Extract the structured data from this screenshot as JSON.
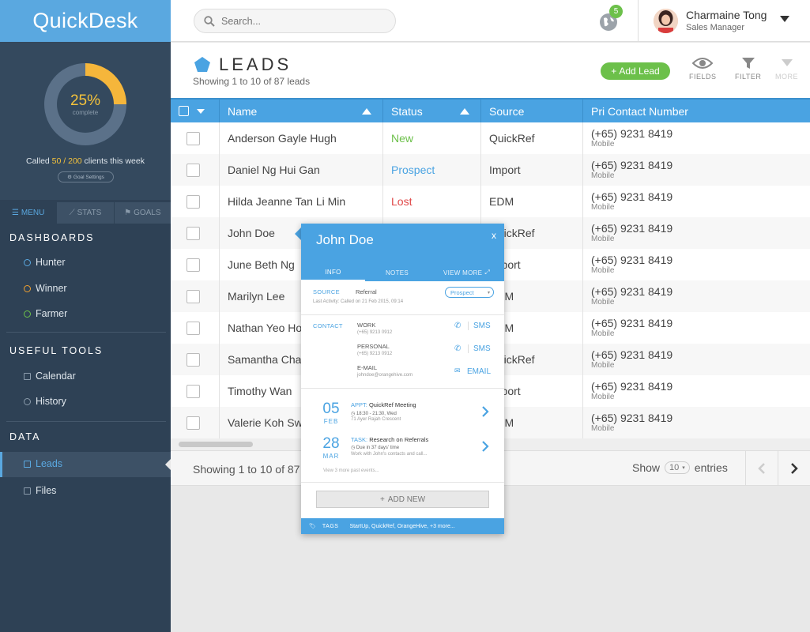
{
  "app": {
    "logo": "QuickDesk"
  },
  "stats": {
    "percent": "25%",
    "percent_value": 0.25,
    "complete_label": "complete",
    "called_prefix": "Called ",
    "called_count": "50 / 200",
    "called_suffix": " clients this week",
    "goal_settings": "Goal Settings"
  },
  "sidebar": {
    "tabs": [
      {
        "label": "MENU"
      },
      {
        "label": "STATS"
      },
      {
        "label": "GOALS"
      }
    ],
    "sections": {
      "dashboards": "DASHBOARDS",
      "useful_tools": "USEFUL TOOLS",
      "data": "DATA"
    },
    "dashboards": [
      {
        "label": "Hunter",
        "color": "#5aa8e0"
      },
      {
        "label": "Winner",
        "color": "#f0a030"
      },
      {
        "label": "Farmer",
        "color": "#6cc04a"
      }
    ],
    "tools": [
      {
        "label": "Calendar"
      },
      {
        "label": "History"
      }
    ],
    "data_items": [
      {
        "label": "Leads"
      },
      {
        "label": "Files"
      }
    ]
  },
  "header": {
    "search_placeholder": "Search...",
    "notifications": "5",
    "user_name": "Charmaine Tong",
    "user_role": "Sales Manager"
  },
  "leads": {
    "title": "LEADS",
    "subtitle": "Showing 1 to 10 of 87 leads",
    "add_label": "Add Lead",
    "actions": {
      "fields": "FIELDS",
      "filter": "FILTER",
      "more": "MORE"
    },
    "columns": {
      "name": "Name",
      "status": "Status",
      "source": "Source",
      "contact": "Pri Contact Number"
    },
    "rows": [
      {
        "name": "Anderson Gayle Hugh",
        "status": "New",
        "status_color": "#6cc04a",
        "source": "QuickRef",
        "phone": "(+65) 9231 8419",
        "phone_type": "Mobile"
      },
      {
        "name": "Daniel Ng Hui Gan",
        "status": "Prospect",
        "status_color": "#4aa3e2",
        "source": "Import",
        "phone": "(+65) 9231 8419",
        "phone_type": "Mobile"
      },
      {
        "name": "Hilda Jeanne Tan Li Min",
        "status": "Lost",
        "status_color": "#e04848",
        "source": "EDM",
        "phone": "(+65) 9231 8419",
        "phone_type": "Mobile"
      },
      {
        "name": "John Doe",
        "status": "",
        "status_color": "#444",
        "source": "QuickRef",
        "phone": "(+65) 9231 8419",
        "phone_type": "Mobile"
      },
      {
        "name": "June Beth Ng",
        "status": "",
        "status_color": "#444",
        "source": "Import",
        "phone": "(+65) 9231 8419",
        "phone_type": "Mobile"
      },
      {
        "name": "Marilyn Lee",
        "status": "",
        "status_color": "#444",
        "source": "EDM",
        "phone": "(+65) 9231 8419",
        "phone_type": "Mobile"
      },
      {
        "name": "Nathan Yeo Ho",
        "status": "",
        "status_color": "#444",
        "source": "EDM",
        "phone": "(+65) 9231 8419",
        "phone_type": "Mobile"
      },
      {
        "name": "Samantha Cha",
        "status": "",
        "status_color": "#444",
        "source": "QuickRef",
        "phone": "(+65) 9231 8419",
        "phone_type": "Mobile"
      },
      {
        "name": "Timothy Wan",
        "status": "",
        "status_color": "#444",
        "source": "Import",
        "phone": "(+65) 9231 8419",
        "phone_type": "Mobile"
      },
      {
        "name": "Valerie Koh Sw",
        "status": "",
        "status_color": "#444",
        "source": "EDM",
        "phone": "(+65) 9231 8419",
        "phone_type": "Mobile"
      }
    ],
    "footer_text": "Showing 1 to 10 of 87",
    "show_label": "Show",
    "entries_value": "10",
    "entries_label": "entries"
  },
  "popup": {
    "name": "John Doe",
    "close": "x",
    "tabs": {
      "info": "INFO",
      "notes": "NOTES",
      "view_more": "VIEW MORE"
    },
    "source_label": "SOURCE",
    "source_value": "Referral",
    "last_activity": "Last Activity: Called on 21 Feb 2015, 09:14",
    "status_value": "Prospect",
    "contact_label": "CONTACT",
    "contacts": [
      {
        "type": "WORK",
        "value": "(+65) 9213 0912",
        "action": "SMS"
      },
      {
        "type": "PERSONAL",
        "value": "(+65) 9213 0912",
        "action": "SMS"
      },
      {
        "type": "E-MAIL",
        "value": "johndoe@orangehive.com",
        "action": "EMAIL"
      }
    ],
    "events": [
      {
        "day": "05",
        "month": "FEB",
        "kind": "APPT:",
        "title": "QuickRef Meeting",
        "line1": "18:30 - 21:30, Wed",
        "line2": "71 Ayer Rajah Crescent"
      },
      {
        "day": "28",
        "month": "MAR",
        "kind": "TASK:",
        "title": "Research on Referrals",
        "line1": "Due in 37 days' time",
        "line2": "Work with John's contacts and call..."
      }
    ],
    "view_past": "View 3 more past events...",
    "add_new": "ADD NEW",
    "tags_label": "TAGS",
    "tags": "StartUp,  QuickRef,  OrangeHive,  +3 more..."
  }
}
